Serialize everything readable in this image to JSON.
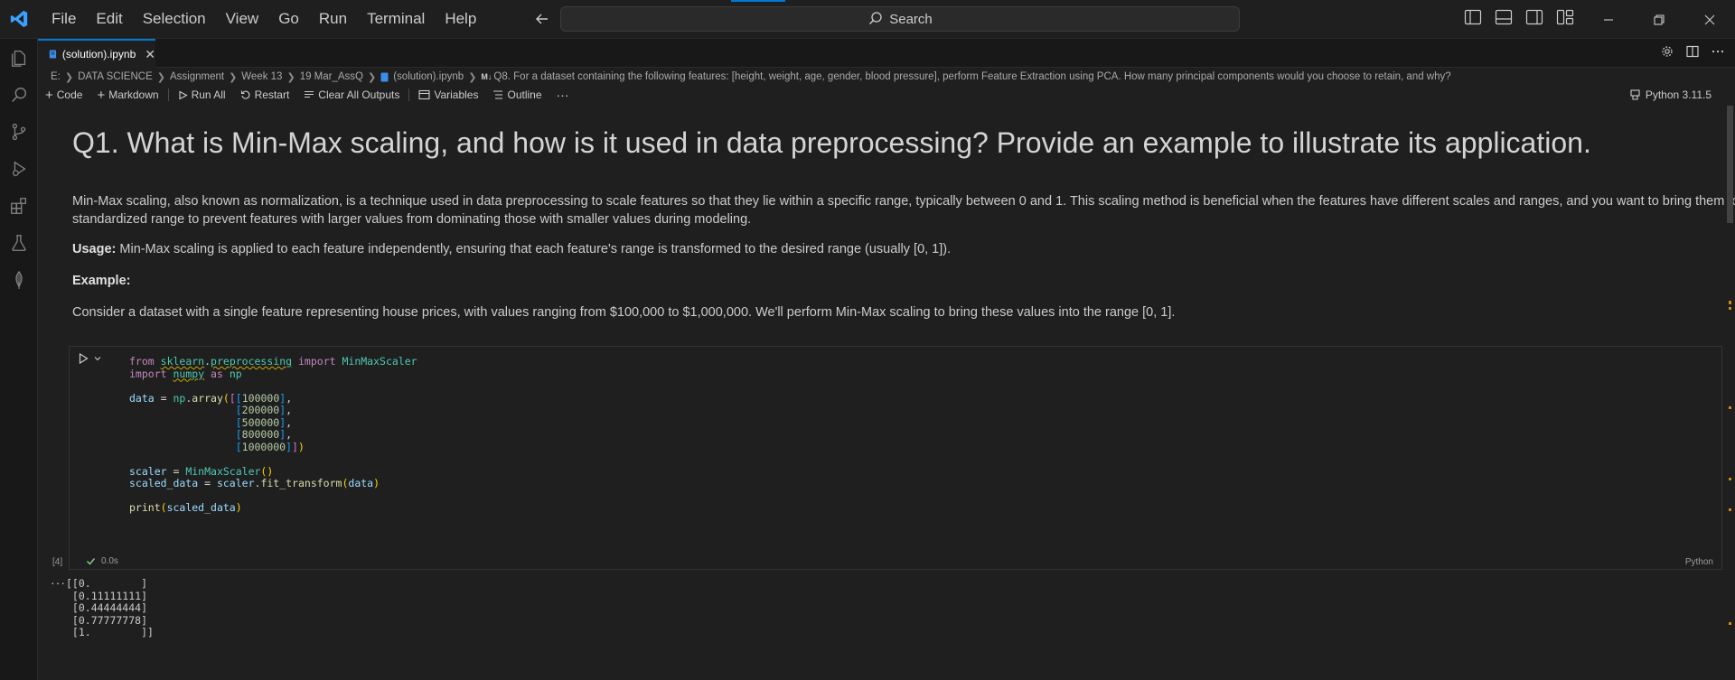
{
  "menu": [
    "File",
    "Edit",
    "Selection",
    "View",
    "Go",
    "Run",
    "Terminal",
    "Help"
  ],
  "search": {
    "label": "Search"
  },
  "tab": {
    "label": "(solution).ipynb",
    "close": "✕"
  },
  "breadcrumb": {
    "items": [
      "E:",
      "DATA SCIENCE",
      "Assignment",
      "Week 13",
      "19 Mar_AssQ",
      "(solution).ipynb",
      "Q8. For a dataset containing the following features: [height, weight, age, gender, blood pressure], perform Feature Extraction using PCA. How many principal components would you choose to retain, and why?"
    ]
  },
  "toolbar": {
    "code": "Code",
    "markdown": "Markdown",
    "run_all": "Run All",
    "restart": "Restart",
    "clear_outputs": "Clear All Outputs",
    "variables": "Variables",
    "outline": "Outline",
    "more": "···",
    "kernel": "Python 3.11.5"
  },
  "markdown": {
    "heading": "Q1. What is Min-Max scaling, and how is it used in data preprocessing? Provide an example to illustrate its application.",
    "para1": "Min-Max scaling, also known as normalization, is a technique used in data preprocessing to scale features so that they lie within a specific range, typically between 0 and 1. This scaling method is beneficial when the features have different scales and ranges, and you want to bring them to a standardized range to prevent features with larger values from dominating those with smaller values during modeling.",
    "usage_label": "Usage:",
    "usage_text": "Min-Max scaling is applied to each feature independently, ensuring that each feature's range is transformed to the desired range (usually [0, 1]).",
    "example_label": "Example:",
    "example_text": "Consider a dataset with a single feature representing house prices, with values ranging from $100,000 to $1,000,000. We'll perform Min-Max scaling to bring these values into the range [0, 1]."
  },
  "cell": {
    "exec_count": "[4]",
    "exec_time": "0.0s",
    "language": "Python",
    "output_more": "···",
    "output": "[[0.        ]\n [0.11111111]\n [0.44444444]\n [0.77777778]\n [1.        ]]"
  },
  "colors": {
    "accent": "#0078d4",
    "success": "#89d185",
    "warning": "#d18616"
  }
}
